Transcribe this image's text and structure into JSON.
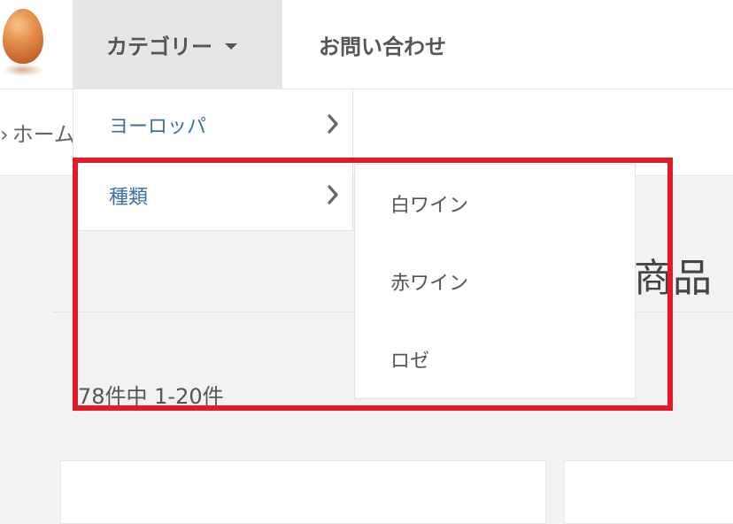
{
  "header": {
    "logo_icon": "egg-logo",
    "nav": {
      "category_label": "カテゴリー",
      "contact_label": "お問い合わせ"
    }
  },
  "breadcrumb": {
    "home_label": "ホーム"
  },
  "main": {
    "title_fragment": "商品",
    "result_count": "78件中 1-20件"
  },
  "dropdown": {
    "level1": [
      {
        "label": "ヨーロッパ",
        "has_submenu": true
      },
      {
        "label": "種類",
        "has_submenu": true
      }
    ],
    "level2": [
      {
        "label": "白ワイン"
      },
      {
        "label": "赤ワイン"
      },
      {
        "label": "ロゼ"
      }
    ]
  },
  "colors": {
    "link": "#3b6fa3",
    "highlight_border": "#e11b2a",
    "nav_active_bg": "#e6e6e6"
  }
}
